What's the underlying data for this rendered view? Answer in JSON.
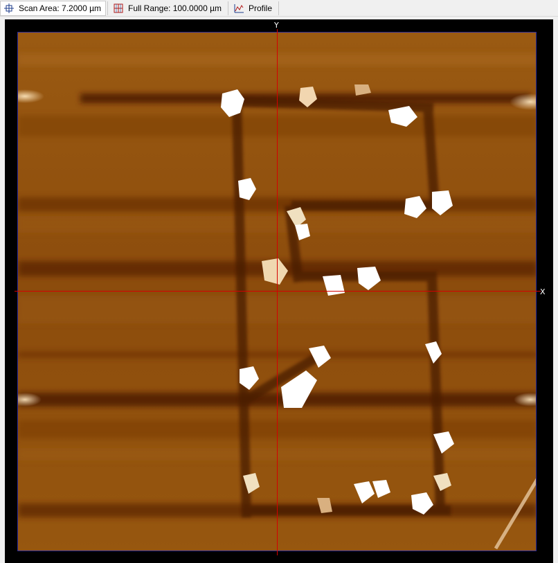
{
  "toolbar": {
    "scan_area_label": "Scan Area: 7.2000 µm",
    "full_range_label": "Full Range: 100.0000 µm",
    "profile_label": "Profile"
  },
  "viewer": {
    "x_axis_label": "X",
    "y_axis_label": "Y",
    "crosshair_color": "#d40000",
    "frame_color": "#2a2a9a",
    "colormap": [
      "#3a1200",
      "#6b3000",
      "#8a4a08",
      "#a06010",
      "#d9a060",
      "#ffffff"
    ]
  }
}
